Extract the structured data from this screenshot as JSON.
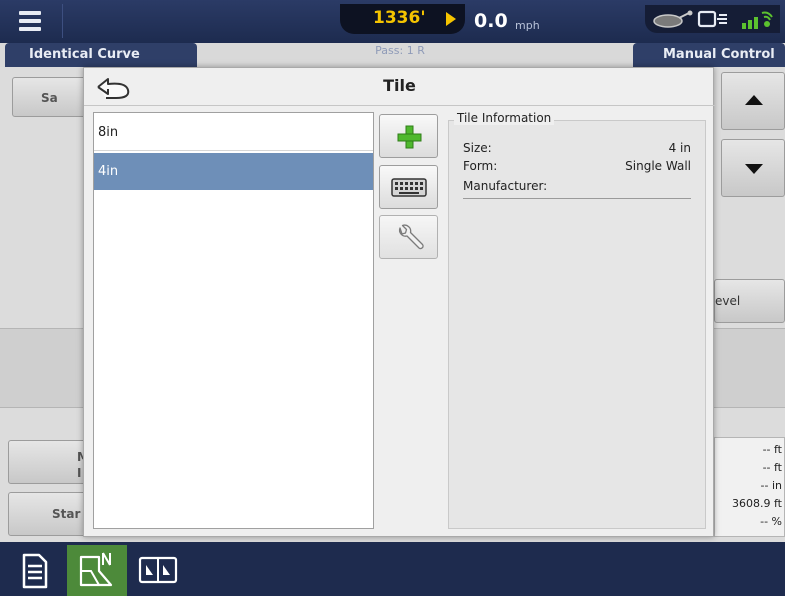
{
  "header": {
    "elevation": "1336'",
    "speed_value": "0.0",
    "speed_unit": "mph",
    "pass_label": "Pass: 1 R",
    "left_tab": "Identical Curve",
    "right_tab": "Manual Control"
  },
  "background": {
    "button_sa": "Sa",
    "button_m_line1": "M",
    "button_m_line2": "I",
    "button_start": "Star",
    "button_level": "evel",
    "readouts": [
      "-- ft",
      "-- ft",
      "-- in",
      "3608.9 ft",
      "-- %"
    ]
  },
  "modal": {
    "title": "Tile",
    "tiles": [
      {
        "label": "8in",
        "selected": false
      },
      {
        "label": "4in",
        "selected": true
      }
    ],
    "info": {
      "heading": "Tile Information",
      "size_key": "Size:",
      "size_value": "4 in",
      "form_key": "Form:",
      "form_value": "Single Wall",
      "manufacturer_key": "Manufacturer:",
      "manufacturer_value": ""
    }
  },
  "icons": {
    "menu": "hamburger-menu-icon",
    "back": "back-arrow-icon",
    "add": "plus-icon",
    "keyboard": "keyboard-icon",
    "edit": "wrench-icon",
    "status": [
      "implement-icon",
      "display-link-icon",
      "gps-signal-icon"
    ],
    "bottom": [
      "report-icon",
      "field-map-icon",
      "split-view-icon"
    ]
  },
  "colors": {
    "topbar": "#1d2b4f",
    "selection": "#6e8fb8",
    "elevation_text": "#f5c400",
    "accent_green": "#4d8a3a",
    "add_icon": "#4fb82e"
  }
}
